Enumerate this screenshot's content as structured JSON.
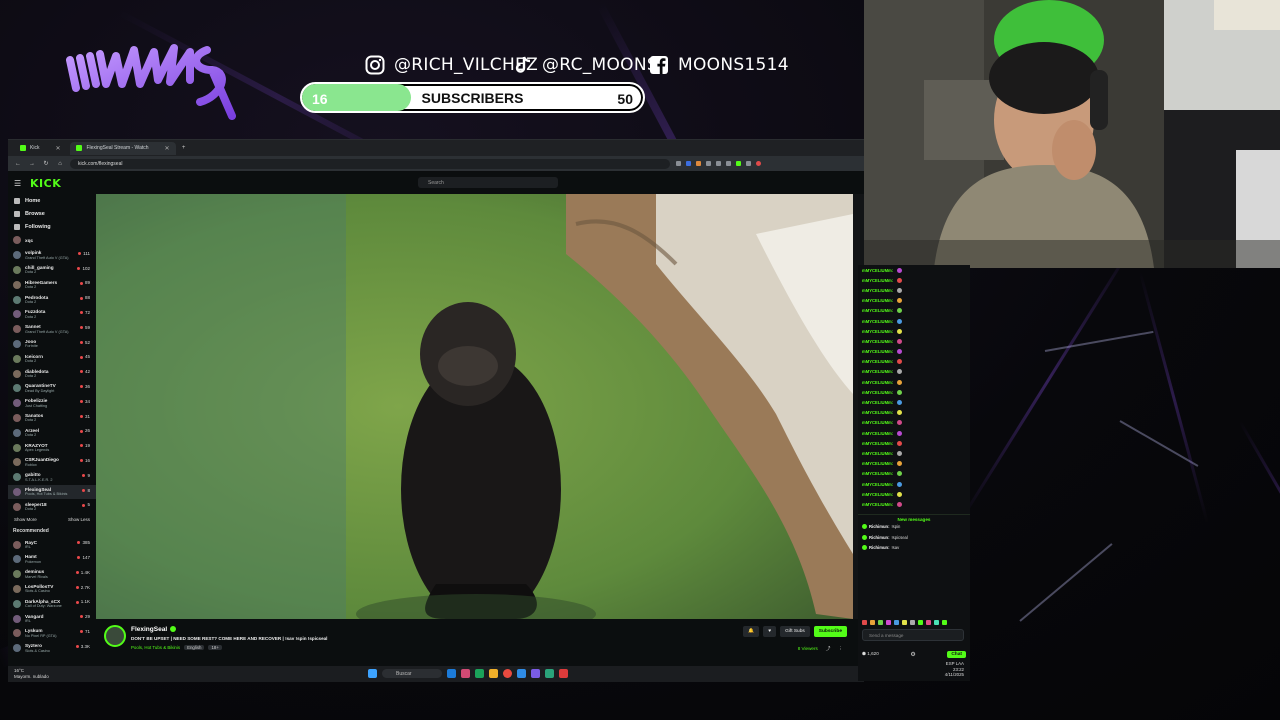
{
  "overlay": {
    "logo_text": "MUNS",
    "socials": [
      {
        "platform_icon": "instagram-icon",
        "handle": "@RICH_VILCHEZ"
      },
      {
        "platform_icon": "tiktok-icon",
        "handle": "@RC_MOONS"
      },
      {
        "platform_icon": "facebook-icon",
        "handle": "MOONS1514"
      }
    ],
    "subgoal": {
      "current": "16",
      "label": "SUBSCRIBERS",
      "goal": "50",
      "progress": 0.32
    },
    "accent_color": "#8a4fe8"
  },
  "browser": {
    "tabs": [
      {
        "label": "Kick",
        "active": false
      },
      {
        "label": "FlexingSeal Stream - Watch",
        "active": true
      }
    ],
    "url": "kick.com/flexingseal"
  },
  "kick": {
    "logo": "KICK",
    "search_placeholder": "Search",
    "nav": [
      {
        "label": "Home",
        "icon": "home-icon"
      },
      {
        "label": "Browse",
        "icon": "compass-icon"
      },
      {
        "label": "Following",
        "icon": "heart-icon"
      }
    ],
    "following": [
      {
        "name": "xqc",
        "game": ""
      },
      {
        "name": "volpink",
        "game": "Grand Theft Auto V (GTA)",
        "count": "111"
      },
      {
        "name": "chill_gaming",
        "game": "Dota 2",
        "count": "102"
      },
      {
        "name": "HibreeGamers",
        "game": "Dota 2",
        "count": "89"
      },
      {
        "name": "Pedrodota",
        "game": "Dota 2",
        "count": "88"
      },
      {
        "name": "Fuzzdota",
        "game": "Dota 2",
        "count": "72"
      },
      {
        "name": "Sannet",
        "game": "Grand Theft Auto V (GTA)",
        "count": "59"
      },
      {
        "name": "Jooo",
        "game": "Fortnite",
        "count": "52"
      },
      {
        "name": "Iceicorn",
        "game": "Dota 2",
        "count": "45"
      },
      {
        "name": "diabledota",
        "game": "Dota 2",
        "count": "42"
      },
      {
        "name": "QuarantineTV",
        "game": "Dead By Daylight",
        "count": "36"
      },
      {
        "name": "Fobelizzie",
        "game": "Just Chatting",
        "count": "34"
      },
      {
        "name": "Sanatos",
        "game": "Dota 2",
        "count": "31"
      },
      {
        "name": "Arzeel",
        "game": "Dota 2",
        "count": "26"
      },
      {
        "name": "KRAZYOT",
        "game": "Apex Legends",
        "count": "19"
      },
      {
        "name": "CSRJuanDiego",
        "game": "Roblox",
        "count": "16"
      },
      {
        "name": "gabitto",
        "game": "S.T.A.L.K.E.R. 2",
        "count": "9"
      },
      {
        "name": "FlexingSeal",
        "game": "Pools, Hot Tubs & Bikinis",
        "count": "8",
        "selected": true
      },
      {
        "name": "sleeper18",
        "game": "Dota 2",
        "count": "5"
      }
    ],
    "show_more": "Show More",
    "show_less": "Show Less",
    "recommended_label": "Recommended",
    "recommended": [
      {
        "name": "RayC",
        "game": "IRL",
        "count": "385"
      },
      {
        "name": "Hamt",
        "game": "Pokemon",
        "count": "147"
      },
      {
        "name": "deminus",
        "game": "Marvel Rivals",
        "count": "1.4K"
      },
      {
        "name": "LosPollosTV",
        "game": "Slots & Casino",
        "count": "2.7K"
      },
      {
        "name": "DarkAlpha_sCX",
        "game": "Call of Duty: Warzone",
        "count": "1.1K"
      },
      {
        "name": "Vangard",
        "game": "IRL",
        "count": "29"
      },
      {
        "name": "Lyskum",
        "game": "No Pixel RP (GTA)",
        "count": "71"
      },
      {
        "name": "Syztero",
        "game": "Slots & Casino",
        "count": "3.3K"
      }
    ],
    "stream": {
      "channel": "FlexingSeal",
      "title": "DON'T BE UPSET | NEED SOME REST? COME HERE AND RECOVER | !sav !spin !spicseal",
      "category": "Pools, Hot Tubs & Bikinis",
      "tags": [
        "English",
        "18+"
      ],
      "buttons": {
        "gift": "Gift Subs",
        "subscribe": "Subscribe"
      },
      "viewers": "8 Viewers"
    }
  },
  "taskbar": {
    "weather_temp": "16°C",
    "weather_desc": "Mayorm. nublado",
    "search": "Buscar"
  },
  "chat": {
    "repeat_user": "mMYCELIUMm:",
    "repeat_count": 24,
    "new_messages_label": "New messages",
    "recent": [
      {
        "user": "Richimun:",
        "msg": "!spin"
      },
      {
        "user": "Richimun:",
        "msg": "!spicseal"
      },
      {
        "user": "Richimun:",
        "msg": "!sav"
      }
    ],
    "input_placeholder": "Send a message",
    "points": "1,620",
    "send_label": "Chat",
    "clock_time": "23:22",
    "clock_date": "4/11/2025",
    "tray_lang": "ESP LAA"
  }
}
